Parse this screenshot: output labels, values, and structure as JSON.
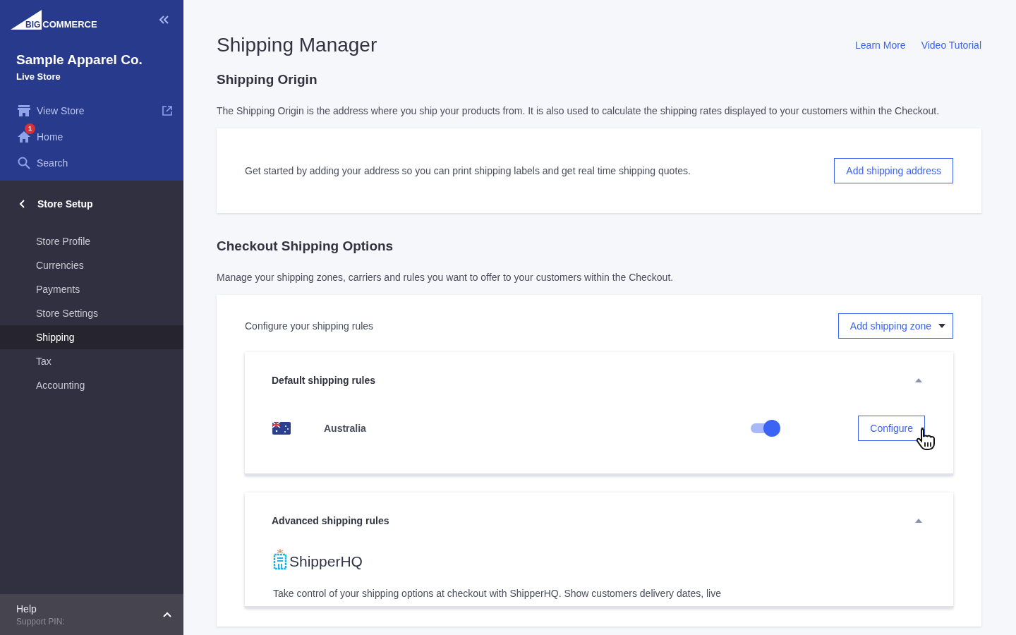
{
  "sidebar": {
    "logo": {
      "mark": "BIG",
      "name": "COMMERCE"
    },
    "store_name": "Sample Apparel Co.",
    "store_status": "Live Store",
    "top_items": [
      {
        "kind": "store",
        "label": "View Store",
        "external": true
      },
      {
        "kind": "home",
        "label": "Home",
        "external": false,
        "badge": "1"
      },
      {
        "kind": "search",
        "label": "Search",
        "external": false
      }
    ],
    "section": "Store Setup",
    "items": [
      {
        "label": "Store Profile",
        "selected": false
      },
      {
        "label": "Currencies",
        "selected": false
      },
      {
        "label": "Payments",
        "selected": false
      },
      {
        "label": "Store Settings",
        "selected": false
      },
      {
        "label": "Shipping",
        "selected": true
      },
      {
        "label": "Tax",
        "selected": false
      },
      {
        "label": "Accounting",
        "selected": false
      }
    ],
    "help": {
      "title": "Help",
      "subtitle": "Support PIN:",
      "expanded": false
    }
  },
  "page": {
    "title": "Shipping Manager",
    "links": [
      "Learn More",
      "Video Tutorial"
    ]
  },
  "origin": {
    "heading": "Shipping Origin",
    "description": "The Shipping Origin is the address where you ship your products from. It is also used to calculate the shipping rates displayed to your customers within the Checkout.",
    "card_text": "Get started by adding your address so you can print shipping labels and get real time shipping quotes.",
    "button": "Add shipping address"
  },
  "checkout": {
    "heading": "Checkout Shipping Options",
    "description": "Manage your shipping zones, carriers and rules you want to offer to your customers within the Checkout.",
    "card_text": "Configure your shipping rules",
    "button": "Add shipping zone",
    "panels": [
      {
        "kind": "zones",
        "title": "Default shipping rules",
        "expanded": true,
        "zones": [
          {
            "country": "Australia",
            "on": true,
            "button": "Configure"
          }
        ]
      },
      {
        "kind": "partner",
        "title": "Advanced shipping rules",
        "expanded": true,
        "partner": "ShipperHQ",
        "text": "Take control of your shipping options at checkout with ShipperHQ. Show customers delivery dates, live"
      }
    ]
  }
}
